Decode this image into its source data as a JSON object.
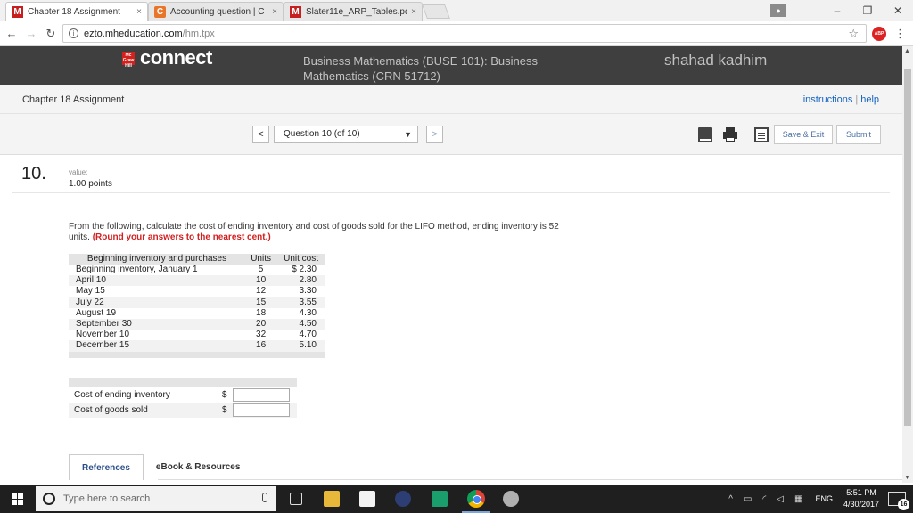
{
  "browser": {
    "tabs": [
      {
        "label": "Chapter 18 Assignment",
        "favicon": "M",
        "favicon_color": "#c51f1f",
        "active": true
      },
      {
        "label": "Accounting question | C",
        "favicon": "C",
        "favicon_color": "#e8752a",
        "active": false
      },
      {
        "label": "Slater11e_ARP_Tables.pd",
        "favicon": "M",
        "favicon_color": "#c51f1f",
        "active": false
      }
    ],
    "tab_close": "×",
    "address_host": "ezto.mheducation.com",
    "address_path": "/hm.tpx",
    "abp_label": "ABP",
    "window_controls": {
      "minimize": "–",
      "restore": "❐",
      "close": "✕"
    }
  },
  "header": {
    "brand_logo_text": "Mc Graw Hill",
    "brand": "connect",
    "course_name": "Business Mathematics (BUSE 101): Business Mathematics (CRN 51712)",
    "student_name": "shahad kadhim"
  },
  "assignment": {
    "title": "Chapter 18 Assignment",
    "instructions_link": "instructions",
    "help_link": "help"
  },
  "toolbar": {
    "prev_label": "<",
    "next_label": ">",
    "question_selector": "Question 10 (of 10)",
    "save_exit_label": "Save & Exit",
    "submit_label": "Submit"
  },
  "question": {
    "number": "10.",
    "value_label": "value:",
    "points": "1.00 points",
    "prompt": "From the following, calculate the cost of ending inventory and cost of goods sold for the LIFO method, ending inventory is 52 units.",
    "instruction": "(Round your answers to the nearest cent.)",
    "table_headers": [
      "Beginning inventory and purchases",
      "Units",
      "Unit cost"
    ],
    "table_rows": [
      [
        "Beginning inventory, January 1",
        "5",
        "$ 2.30"
      ],
      [
        "April 10",
        "10",
        "2.80"
      ],
      [
        "May 15",
        "12",
        "3.30"
      ],
      [
        "July 22",
        "15",
        "3.55"
      ],
      [
        "August 19",
        "18",
        "4.30"
      ],
      [
        "September 30",
        "20",
        "4.50"
      ],
      [
        "November 10",
        "32",
        "4.70"
      ],
      [
        "December 15",
        "16",
        "5.10"
      ]
    ],
    "answers": [
      {
        "label": "Cost of ending inventory",
        "currency": "$",
        "value": ""
      },
      {
        "label": "Cost of goods sold",
        "currency": "$",
        "value": ""
      }
    ]
  },
  "bottom_tabs": {
    "references": "References",
    "ebook": "eBook & Resources"
  },
  "taskbar": {
    "search_placeholder": "Type here to search",
    "language": "ENG",
    "time": "5:51 PM",
    "date": "4/30/2017",
    "notification_count": "16"
  }
}
